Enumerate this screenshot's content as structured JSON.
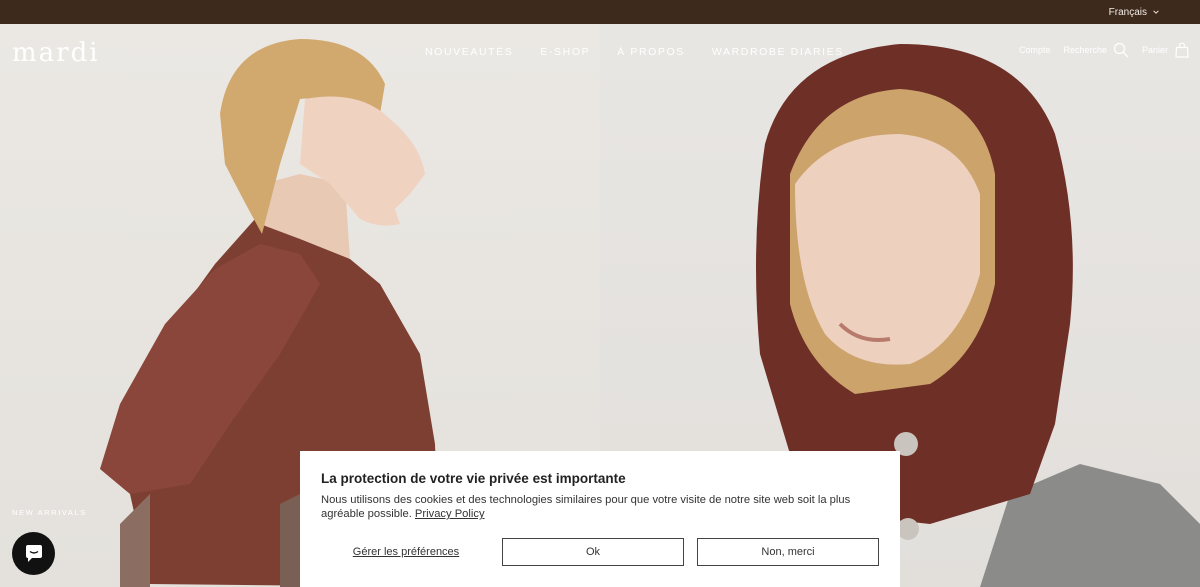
{
  "topbar": {
    "language": "Français",
    "language_icon": "chevron-down-icon"
  },
  "header": {
    "logo": "mardi",
    "nav": [
      "NOUVEAUTÉS",
      "E-SHOP",
      "À PROPOS",
      "WARDROBE DIARIES"
    ],
    "account": "Compte",
    "search": "Recherche",
    "cart": "Panier"
  },
  "hero": {
    "left_caption": "NEW ARRIVALS"
  },
  "cookie": {
    "title": "La protection de votre vie privée est importante",
    "text": "Nous utilisons des cookies et des technologies similaires pour que votre visite de notre site web soit la plus agréable possible.",
    "link": "Privacy Policy",
    "preferences": "Gérer les préférences",
    "ok": "Ok",
    "decline": "Non, merci"
  },
  "colors": {
    "topbar": "#3e2a1d",
    "knit": "#7a3a2f"
  }
}
